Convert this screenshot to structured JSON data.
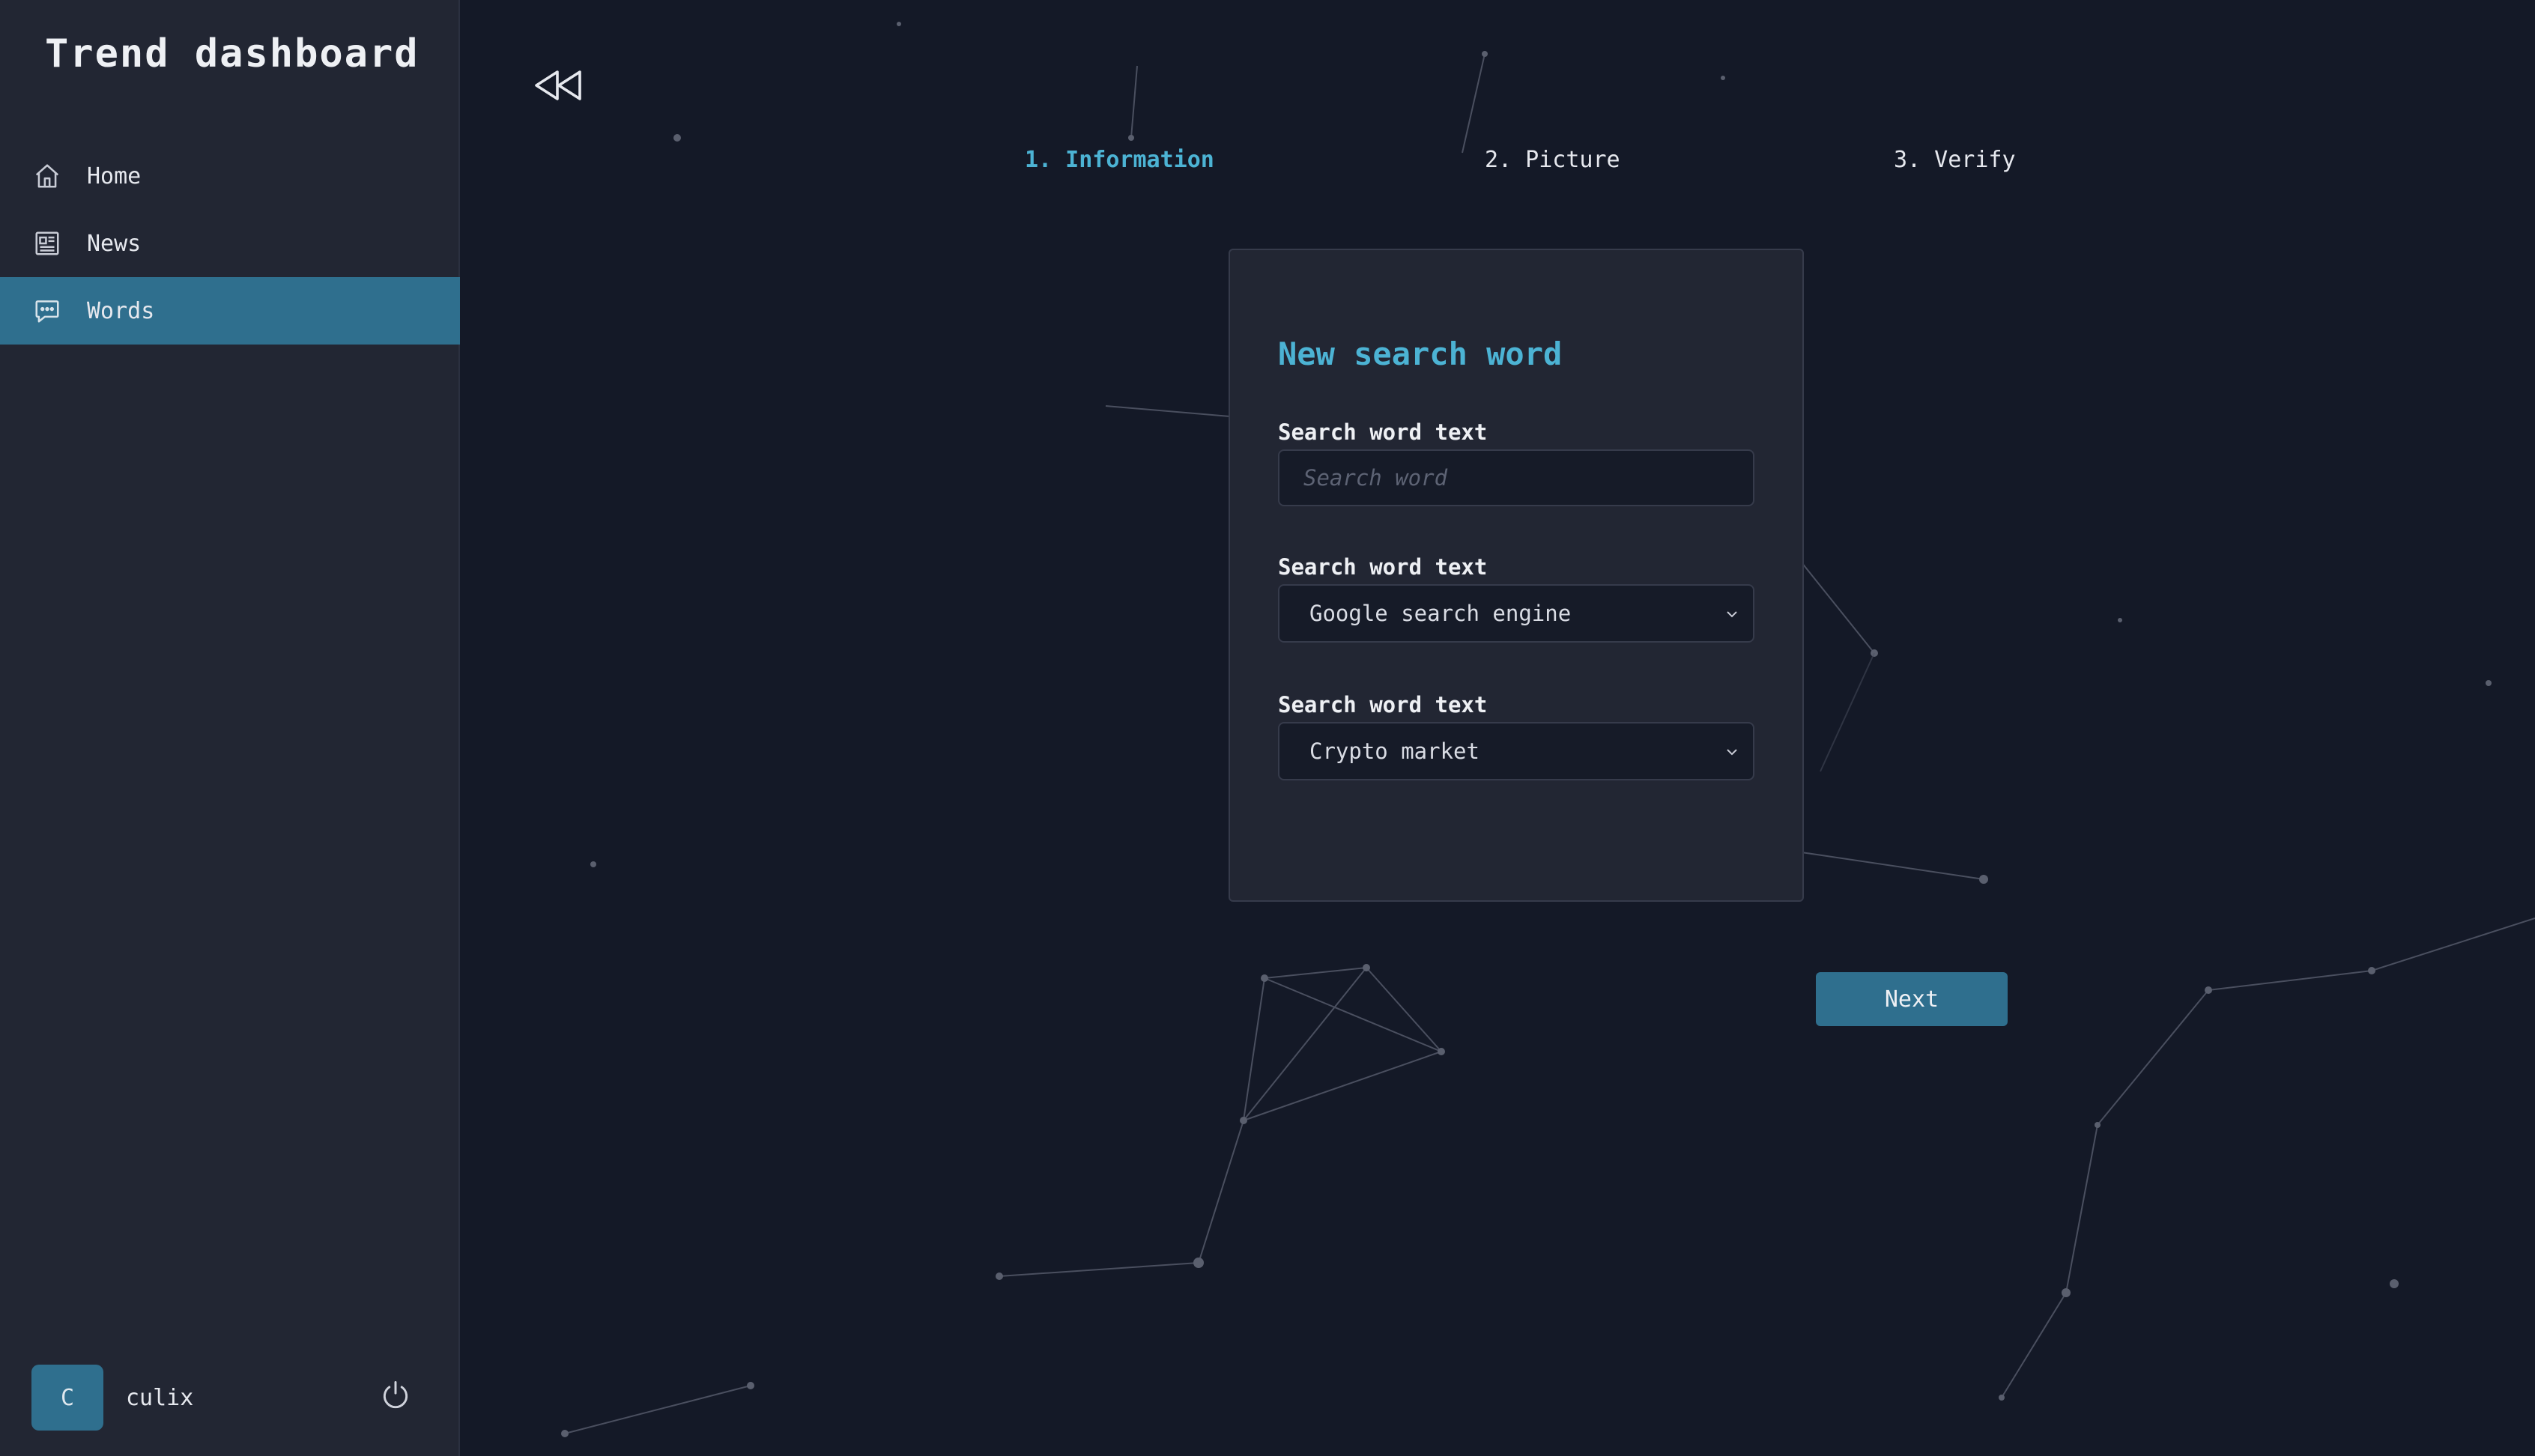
{
  "app": {
    "title": "Trend dashboard"
  },
  "sidebar": {
    "items": [
      {
        "label": "Home",
        "icon": "home-icon",
        "active": false
      },
      {
        "label": "News",
        "icon": "newspaper-icon",
        "active": false
      },
      {
        "label": "Words",
        "icon": "chat-bubble-icon",
        "active": true
      }
    ],
    "user": {
      "initial": "C",
      "name": "culix"
    }
  },
  "wizard": {
    "steps": [
      {
        "label": "1. Information",
        "active": true
      },
      {
        "label": "2. Picture",
        "active": false
      },
      {
        "label": "3. Verify",
        "active": false
      }
    ]
  },
  "form": {
    "title": "New search word",
    "fields": [
      {
        "label": "Search word text",
        "type": "text",
        "value": "",
        "placeholder": "Search word"
      },
      {
        "label": "Search word text",
        "type": "select",
        "value": "Google search engine"
      },
      {
        "label": "Search word text",
        "type": "select",
        "value": "Crypto market"
      }
    ],
    "next_label": "Next"
  },
  "colors": {
    "background": "#141927",
    "sidebar": "#222633",
    "accent": "#2f6f8e",
    "highlight": "#4cb3d4"
  }
}
